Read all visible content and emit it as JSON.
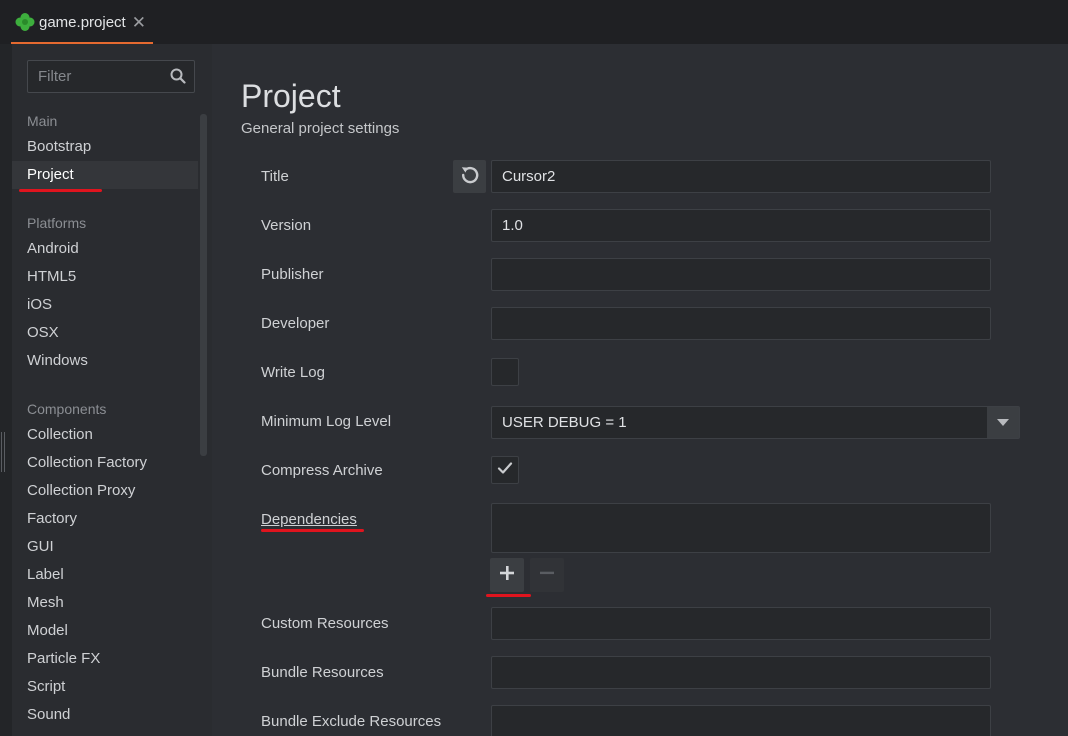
{
  "tab": {
    "title": "game.project",
    "close": "✕"
  },
  "sidebar": {
    "filter_placeholder": "Filter",
    "groups": [
      {
        "heading": "Main",
        "items": [
          "Bootstrap",
          "Project"
        ]
      },
      {
        "heading": "Platforms",
        "items": [
          "Android",
          "HTML5",
          "iOS",
          "OSX",
          "Windows"
        ]
      },
      {
        "heading": "Components",
        "items": [
          "Collection",
          "Collection Factory",
          "Collection Proxy",
          "Factory",
          "GUI",
          "Label",
          "Mesh",
          "Model",
          "Particle FX",
          "Script",
          "Sound"
        ]
      }
    ],
    "active_item": "Project"
  },
  "page": {
    "title": "Project",
    "subtitle": "General project settings"
  },
  "fields": {
    "title": {
      "label": "Title",
      "value": "Cursor2"
    },
    "version": {
      "label": "Version",
      "value": "1.0"
    },
    "publisher": {
      "label": "Publisher",
      "value": ""
    },
    "developer": {
      "label": "Developer",
      "value": ""
    },
    "write_log": {
      "label": "Write Log",
      "checked": false
    },
    "min_log_level": {
      "label": "Minimum Log Level",
      "value": "USER DEBUG = 1"
    },
    "compress_archive": {
      "label": "Compress Archive",
      "checked": true
    },
    "dependencies": {
      "label": "Dependencies",
      "add": "+",
      "remove": "−"
    },
    "custom_resources": {
      "label": "Custom Resources",
      "value": ""
    },
    "bundle_resources": {
      "label": "Bundle Resources",
      "value": ""
    },
    "bundle_exclude_resources": {
      "label": "Bundle Exclude Resources",
      "value": ""
    }
  },
  "colors": {
    "accent": "#e56a30",
    "annotation": "#e0141e",
    "defold_green": "#3dae3d"
  },
  "icons": {
    "tab": "defold-logo-icon",
    "search": "search-icon",
    "revert": "revert-icon",
    "dropdown": "chevron-down-icon",
    "check": "checkmark-icon"
  }
}
